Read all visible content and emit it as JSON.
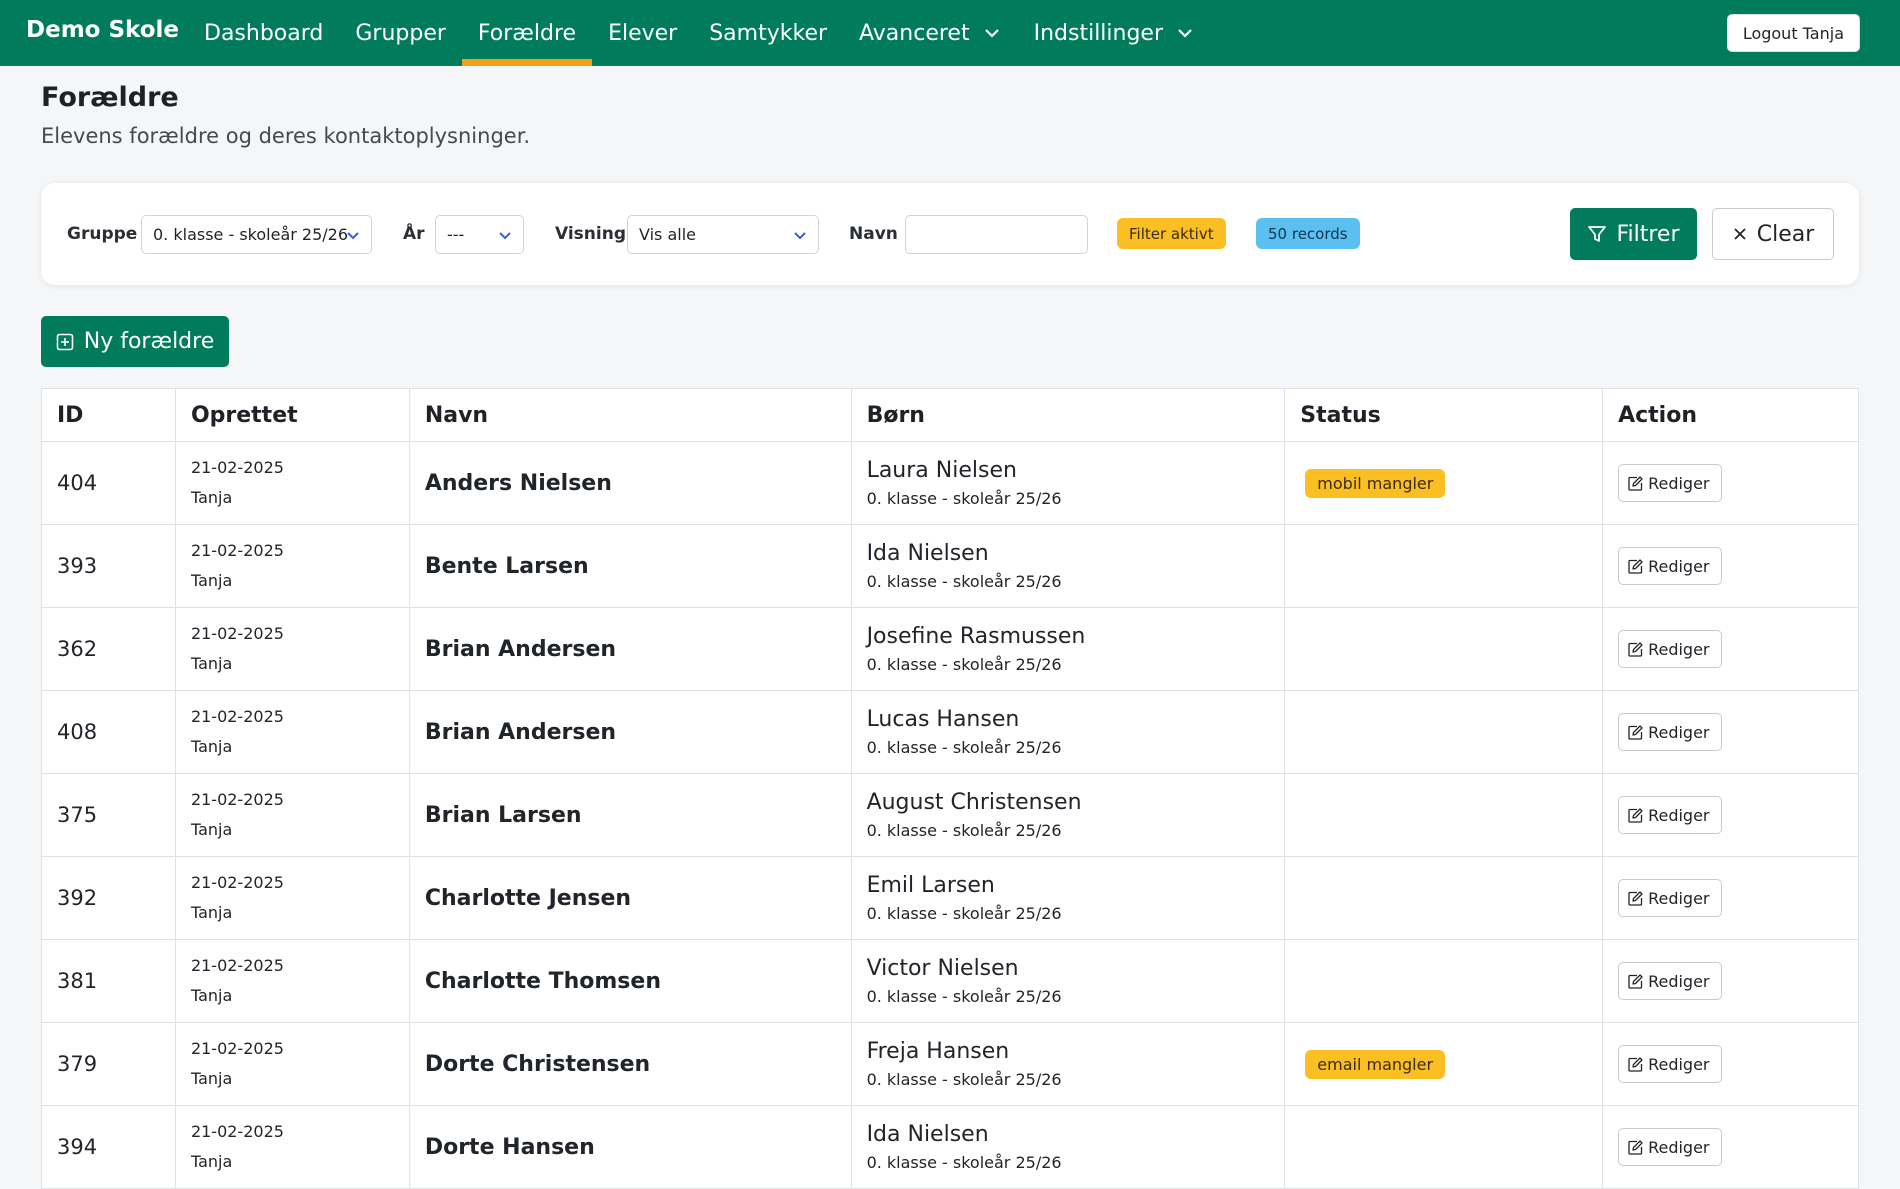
{
  "navbar": {
    "brand": "Demo Skole",
    "items": [
      {
        "label": "Dashboard",
        "active": false,
        "dropdown": false
      },
      {
        "label": "Grupper",
        "active": false,
        "dropdown": false
      },
      {
        "label": "Forældre",
        "active": true,
        "dropdown": false
      },
      {
        "label": "Elever",
        "active": false,
        "dropdown": false
      },
      {
        "label": "Samtykker",
        "active": false,
        "dropdown": false
      },
      {
        "label": "Avanceret",
        "active": false,
        "dropdown": true
      },
      {
        "label": "Indstillinger",
        "active": false,
        "dropdown": true
      }
    ],
    "logout_label": "Logout Tanja"
  },
  "page": {
    "title": "Forældre",
    "subtitle": "Elevens forældre og deres kontaktoplysninger."
  },
  "filters": {
    "group_label": "Gruppe",
    "group_value": "0. klasse - skoleår 25/26",
    "year_label": "År",
    "year_value": "---",
    "view_label": "Visning",
    "view_value": "Vis alle",
    "name_label": "Navn",
    "name_value": "",
    "filter_active_badge": "Filter aktivt",
    "records_badge": "50 records",
    "filter_button": "Filtrer",
    "clear_button": "Clear"
  },
  "new_button": "Ny forældre",
  "table": {
    "columns": [
      "ID",
      "Oprettet",
      "Navn",
      "Børn",
      "Status",
      "Action"
    ],
    "rows": [
      {
        "id": "404",
        "date": "21-02-2025",
        "user": "Tanja",
        "name": "Anders Nielsen",
        "child": "Laura Nielsen",
        "group": "0. klasse - skoleår 25/26",
        "status": "mobil mangler",
        "action": "Rediger"
      },
      {
        "id": "393",
        "date": "21-02-2025",
        "user": "Tanja",
        "name": "Bente Larsen",
        "child": "Ida Nielsen",
        "group": "0. klasse - skoleår 25/26",
        "status": "",
        "action": "Rediger"
      },
      {
        "id": "362",
        "date": "21-02-2025",
        "user": "Tanja",
        "name": "Brian Andersen",
        "child": "Josefine Rasmussen",
        "group": "0. klasse - skoleår 25/26",
        "status": "",
        "action": "Rediger"
      },
      {
        "id": "408",
        "date": "21-02-2025",
        "user": "Tanja",
        "name": "Brian Andersen",
        "child": "Lucas Hansen",
        "group": "0. klasse - skoleår 25/26",
        "status": "",
        "action": "Rediger"
      },
      {
        "id": "375",
        "date": "21-02-2025",
        "user": "Tanja",
        "name": "Brian Larsen",
        "child": "August Christensen",
        "group": "0. klasse - skoleår 25/26",
        "status": "",
        "action": "Rediger"
      },
      {
        "id": "392",
        "date": "21-02-2025",
        "user": "Tanja",
        "name": "Charlotte Jensen",
        "child": "Emil Larsen",
        "group": "0. klasse - skoleår 25/26",
        "status": "",
        "action": "Rediger"
      },
      {
        "id": "381",
        "date": "21-02-2025",
        "user": "Tanja",
        "name": "Charlotte Thomsen",
        "child": "Victor Nielsen",
        "group": "0. klasse - skoleår 25/26",
        "status": "",
        "action": "Rediger"
      },
      {
        "id": "379",
        "date": "21-02-2025",
        "user": "Tanja",
        "name": "Dorte Christensen",
        "child": "Freja Hansen",
        "group": "0. klasse - skoleår 25/26",
        "status": "email mangler",
        "action": "Rediger"
      },
      {
        "id": "394",
        "date": "21-02-2025",
        "user": "Tanja",
        "name": "Dorte Hansen",
        "child": "Ida Nielsen",
        "group": "0. klasse - skoleår 25/26",
        "status": "",
        "action": "Rediger"
      }
    ]
  },
  "colors": {
    "primary": "#007c5c",
    "active_tab_underline": "#f4a11a",
    "warning_badge": "#fbbf24",
    "info_badge": "#5bc0f0"
  }
}
